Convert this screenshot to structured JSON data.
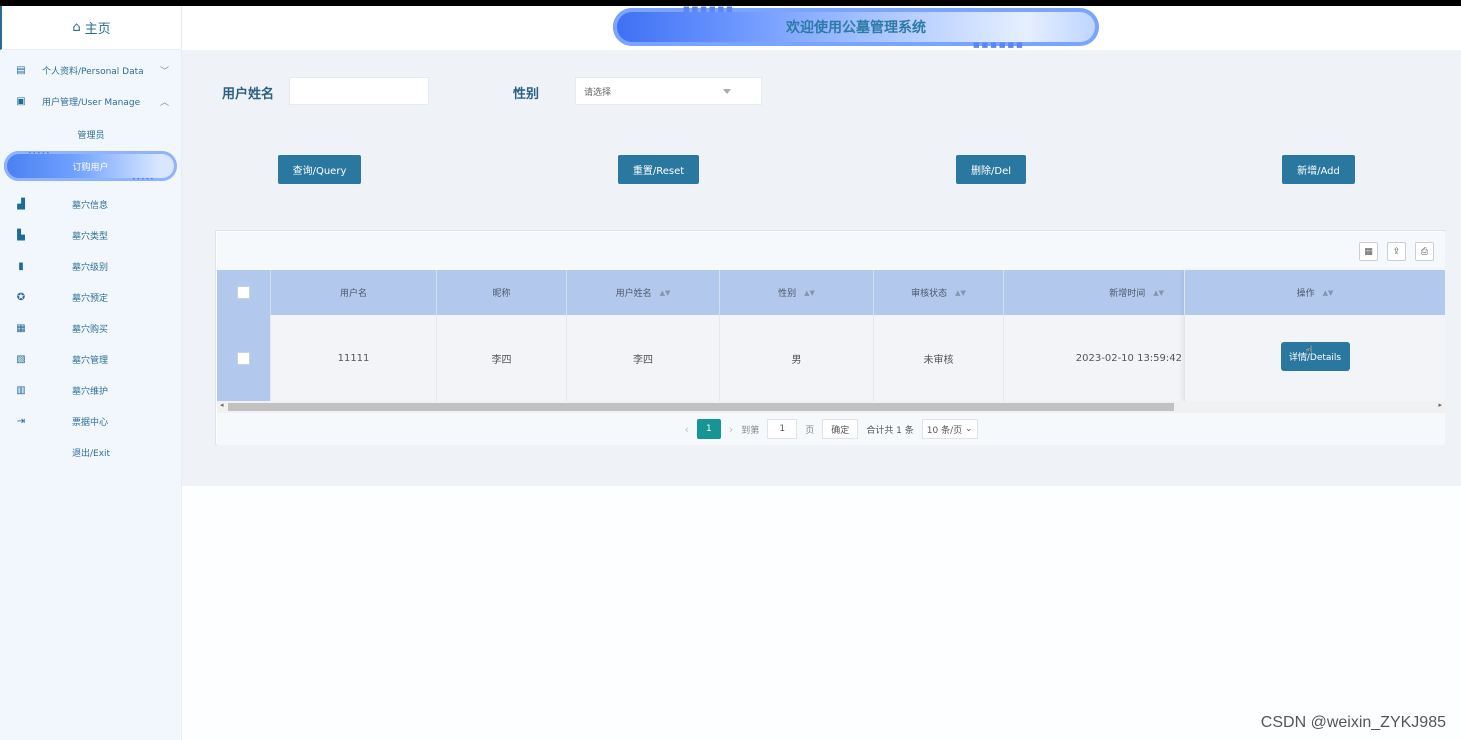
{
  "sidebar": {
    "home": "主页",
    "personal": "个人资料/Personal Data",
    "user_manage": "用户管理/User Manage",
    "sub_admin": "管理员",
    "sub_orderuser": "订购用户",
    "items": [
      {
        "label": "墓穴信息",
        "icon": "building-icon"
      },
      {
        "label": "墓穴类型",
        "icon": "chart-icon"
      },
      {
        "label": "墓穴级别",
        "icon": "bookmark-icon"
      },
      {
        "label": "墓穴预定",
        "icon": "user-gear-icon"
      },
      {
        "label": "墓穴购买",
        "icon": "calendar-icon"
      },
      {
        "label": "墓穴管理",
        "icon": "calendar-check-icon"
      },
      {
        "label": "墓穴维护",
        "icon": "book-icon"
      },
      {
        "label": "票据中心",
        "icon": "logout-box-icon"
      },
      {
        "label": "退出/Exit",
        "icon": ""
      }
    ]
  },
  "header": {
    "title": "欢迎使用公墓管理系统"
  },
  "search": {
    "name_label": "用户姓名",
    "name_value": "",
    "gender_label": "性别",
    "gender_placeholder": "请选择"
  },
  "actions": {
    "query": "查询/Query",
    "reset": "重置/Reset",
    "delete": "删除/Del",
    "add": "新增/Add"
  },
  "table": {
    "columns": [
      "用户名",
      "昵称",
      "用户姓名",
      "性别",
      "审核状态",
      "新增时间",
      "操作"
    ],
    "rows": [
      {
        "username": "11111",
        "nickname": "李四",
        "realname": "李四",
        "gender": "男",
        "status": "未审核",
        "created": "2023-02-10 13:59:42",
        "action": "详情/Details"
      }
    ]
  },
  "pagination": {
    "current": "1",
    "goto_label": "到第",
    "goto_value": "1",
    "page_unit": "页",
    "confirm": "确定",
    "total": "合计共 1 条",
    "page_size": "10 条/页"
  },
  "watermark": "CSDN @weixin_ZYKJ985",
  "colors": {
    "accent": "#2a78a0",
    "header_row": "#b3c8ed",
    "pager_active": "#179494"
  }
}
